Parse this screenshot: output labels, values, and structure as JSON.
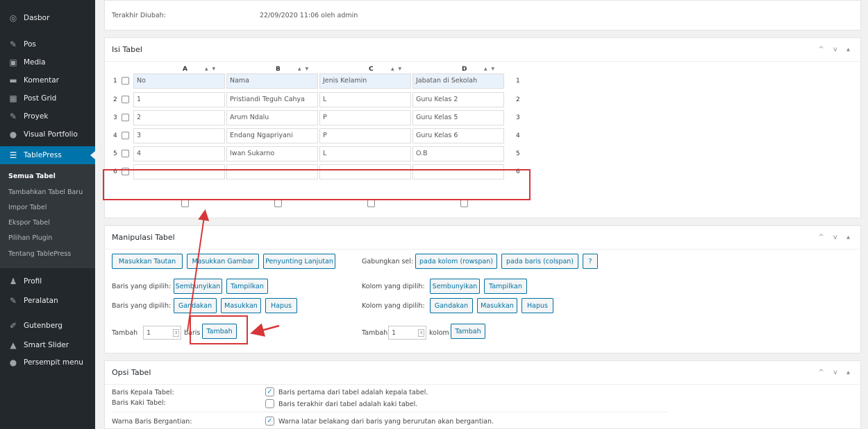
{
  "sidebar": {
    "items": [
      {
        "label": "Dasbor",
        "icon": "dashboard-icon",
        "glyph": "◎"
      },
      {
        "label": "Pos",
        "icon": "pin-icon",
        "glyph": "✎"
      },
      {
        "label": "Media",
        "icon": "media-icon",
        "glyph": "▣"
      },
      {
        "label": "Komentar",
        "icon": "comment-icon",
        "glyph": "▬"
      },
      {
        "label": "Post Grid",
        "icon": "grid-icon",
        "glyph": "▦"
      },
      {
        "label": "Proyek",
        "icon": "pin-icon",
        "glyph": "✎"
      },
      {
        "label": "Visual Portfolio",
        "icon": "portfolio-icon",
        "glyph": "●"
      },
      {
        "label": "TablePress",
        "icon": "table-icon",
        "glyph": "☰"
      },
      {
        "label": "Profil",
        "icon": "user-icon",
        "glyph": "♟"
      },
      {
        "label": "Peralatan",
        "icon": "wrench-icon",
        "glyph": "✎"
      },
      {
        "label": "Gutenberg",
        "icon": "pencil-icon",
        "glyph": "✐"
      },
      {
        "label": "Smart Slider",
        "icon": "slider-icon",
        "glyph": "▲"
      },
      {
        "label": "Persempit menu",
        "icon": "collapse-icon",
        "glyph": "●"
      }
    ],
    "submenu": [
      "Semua Tabel",
      "Tambahkan Tabel Baru",
      "Impor Tabel",
      "Ekspor Tabel",
      "Pilihan Plugin",
      "Tentang TablePress"
    ]
  },
  "info": {
    "label": "Terakhir Diubah:",
    "value": "22/09/2020 11:06 oleh admin"
  },
  "isi_tabel": {
    "title": "Isi Tabel",
    "controls": "^ v ▴",
    "columns": [
      "A",
      "B",
      "C",
      "D"
    ],
    "sort": "▲ ▼",
    "rows": [
      {
        "n": "1",
        "cells": [
          "No",
          "Nama",
          "Jenis Kelamin",
          "Jabatan di Sekolah"
        ]
      },
      {
        "n": "2",
        "cells": [
          "1",
          "Pristiandi Teguh Cahya",
          "L",
          "Guru Kelas 2"
        ]
      },
      {
        "n": "3",
        "cells": [
          "2",
          "Arum Ndalu",
          "P",
          "Guru Kelas 5"
        ]
      },
      {
        "n": "4",
        "cells": [
          "3",
          "Endang Ngapriyani",
          "P",
          "Guru Kelas 6"
        ]
      },
      {
        "n": "5",
        "cells": [
          "4",
          "Iwan Sukarno",
          "L",
          "O.B"
        ]
      },
      {
        "n": "6",
        "cells": [
          "",
          "",
          "",
          ""
        ]
      }
    ]
  },
  "manipulasi": {
    "title": "Manipulasi Tabel",
    "buttons_top": [
      "Masukkan Tautan",
      "Masukkan Gambar",
      "Penyunting Lanjutan"
    ],
    "gabung_label": "Gabungkan sel:",
    "gabung_buttons": [
      "pada kolom (rowspan)",
      "pada baris (colspan)",
      "?"
    ],
    "rows_selected_label": "Baris yang dipilih:",
    "cols_selected_label": "Kolom yang dipilih:",
    "hide_show": [
      "Sembunyikan",
      "Tampilkan"
    ],
    "dup_ins_del": [
      "Gandakan",
      "Masukkan",
      "Hapus"
    ],
    "add_label": "Tambah",
    "add_rows_value": "1",
    "rows_unit": "baris",
    "cols_unit": "kolom",
    "add_button": "Tambah",
    "add_cols_value": "1"
  },
  "opsi": {
    "title": "Opsi Tabel",
    "items": [
      {
        "label": "Baris Kepala Tabel:",
        "checked": true,
        "text": "Baris pertama dari tabel adalah kepala tabel."
      },
      {
        "label": "Baris Kaki Tabel:",
        "checked": false,
        "text": "Baris terakhir dari tabel adalah kaki tabel."
      },
      {
        "label": "Warna Baris Bergantian:",
        "checked": true,
        "text": "Warna latar belakang dari baris yang berurutan akan bergantian."
      }
    ]
  },
  "colors": {
    "sidebar": "#23282d",
    "accent": "#0073aa",
    "highlight": "#d63638"
  }
}
